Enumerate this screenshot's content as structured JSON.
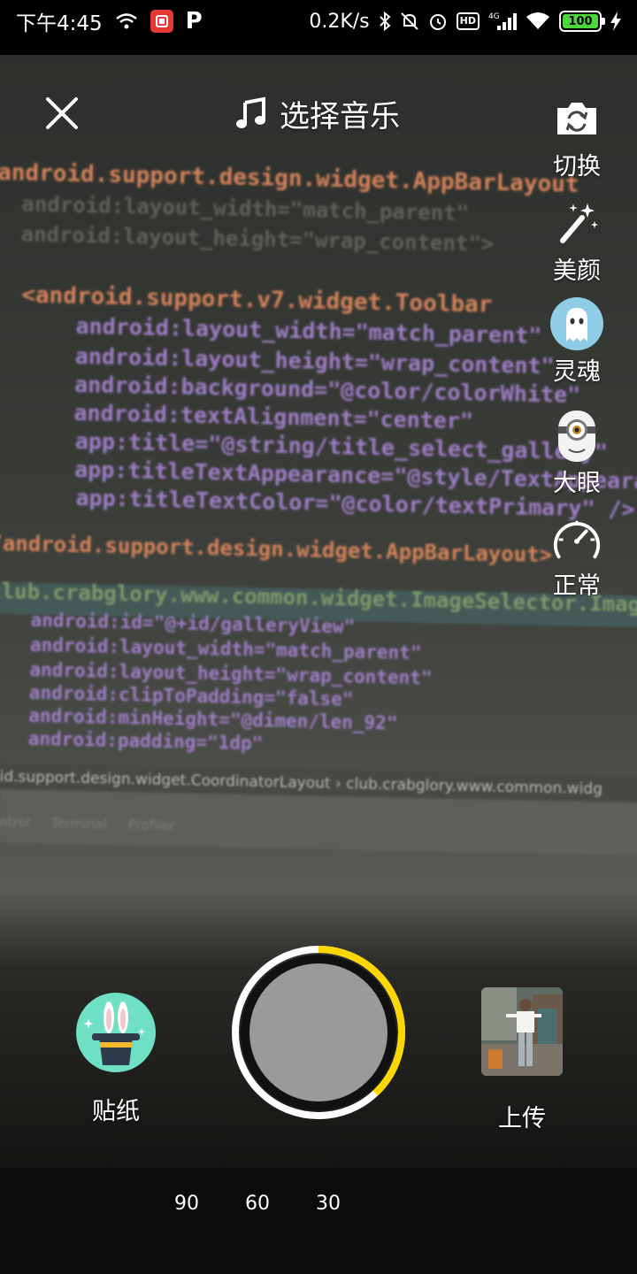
{
  "status_bar": {
    "time": "下午4:45",
    "speed": "0.2K/s",
    "battery": "100",
    "network": "4G",
    "hd": "HD"
  },
  "viewfinder": {
    "code_lines": [
      {
        "text": "android.support.design.widget.AppBarLayout",
        "cls": "c-orange"
      },
      {
        "text": "android:layout_width=\"match_parent\"",
        "cls": "c-dim"
      },
      {
        "text": "android:layout_height=\"wrap_content\">",
        "cls": "c-dim"
      },
      {
        "text": "<android.support.v7.widget.Toolbar",
        "cls": "c-orange"
      },
      {
        "text": "android:layout_width=\"match_parent\"",
        "cls": "c-purple"
      },
      {
        "text": "android:layout_height=\"wrap_content\"",
        "cls": "c-purple"
      },
      {
        "text": "android:background=\"@color/colorWhite\"",
        "cls": "c-purple"
      },
      {
        "text": "android:textAlignment=\"center\"",
        "cls": "c-purple"
      },
      {
        "text": "app:title=\"@string/title_select_gallery\"",
        "cls": "c-purple"
      },
      {
        "text": "app:titleTextAppearance=\"@style/TextAppearance\"",
        "cls": "c-purple"
      },
      {
        "text": "app:titleTextColor=\"@color/textPrimary\" />",
        "cls": "c-purple"
      },
      {
        "text": "/android.support.design.widget.AppBarLayout>",
        "cls": "c-orange"
      },
      {
        "text": "club.crabglory.www.common.widget.ImageSelector.Image",
        "cls": "c-green"
      },
      {
        "text": "android:id=\"@+id/galleryView\"",
        "cls": "c-purple"
      },
      {
        "text": "android:layout_width=\"match_parent\"",
        "cls": "c-purple"
      },
      {
        "text": "android:layout_height=\"wrap_content\"",
        "cls": "c-purple"
      },
      {
        "text": "android:clipToPadding=\"false\"",
        "cls": "c-purple"
      },
      {
        "text": "android:minHeight=\"@dimen/len_92\"",
        "cls": "c-purple"
      },
      {
        "text": "android:padding=\"1dp\"",
        "cls": "c-purple"
      }
    ],
    "ide_breadcrumb": "id.support.design.widget.CoordinatorLayout  ›  club.crabglory.www.common.widg",
    "ide_tabs": "ntrol     Terminal     Profiler"
  },
  "top_bar": {
    "music_label": "选择音乐"
  },
  "side_controls": [
    {
      "name": "switch-camera",
      "label": "切换",
      "icon": "camera-switch-icon"
    },
    {
      "name": "beauty",
      "label": "美颜",
      "icon": "magic-wand-icon"
    },
    {
      "name": "soul",
      "label": "灵魂",
      "icon": "ghost-icon"
    },
    {
      "name": "big-eye",
      "label": "大眼",
      "icon": "minion-eye-icon"
    },
    {
      "name": "speed",
      "label": "正常",
      "icon": "speedometer-icon"
    }
  ],
  "bottom": {
    "sticker_label": "贴纸",
    "upload_label": "上传",
    "shutter_progress": 0.38
  },
  "durations": [
    "90",
    "60",
    "30"
  ],
  "colors": {
    "accent": "#FFD700",
    "sticker_bg": "#6FE0C3",
    "battery": "#4CD83A"
  }
}
